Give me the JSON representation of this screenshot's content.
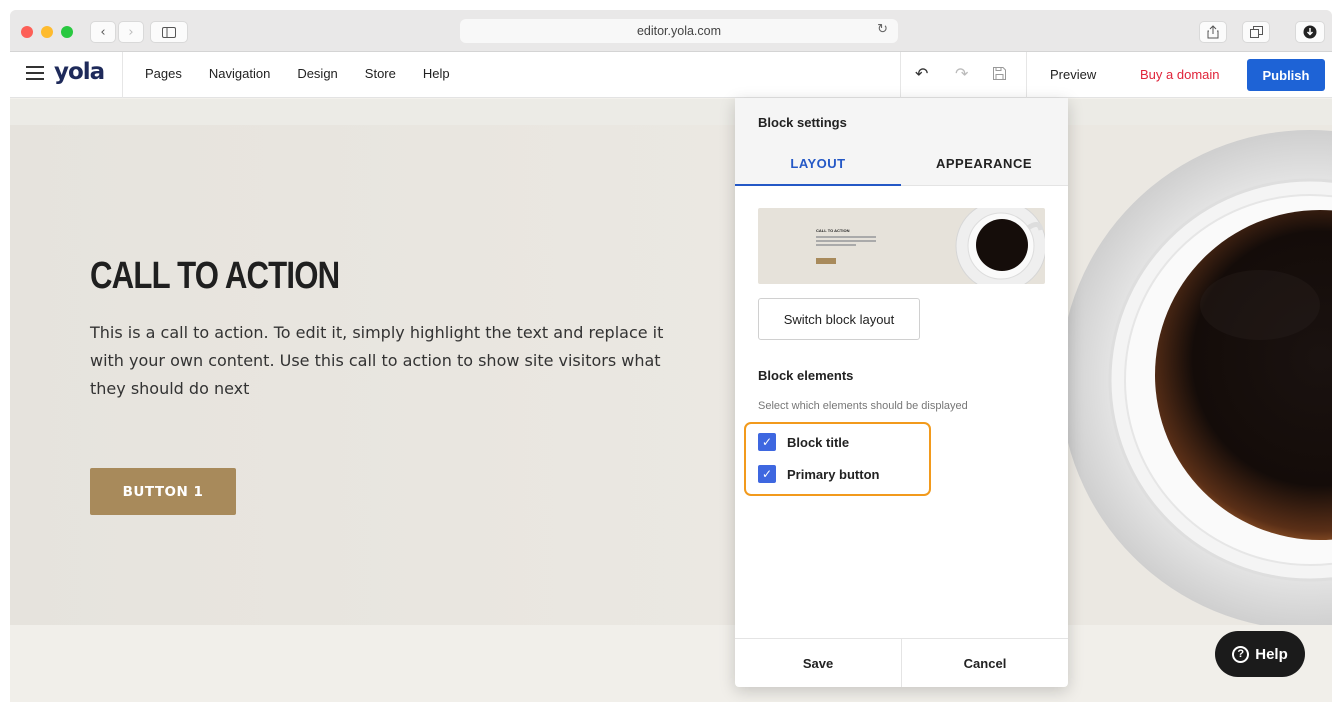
{
  "browser": {
    "url": "editor.yola.com"
  },
  "toolbar": {
    "logo": "yola",
    "nav": [
      "Pages",
      "Navigation",
      "Design",
      "Store",
      "Help"
    ],
    "preview": "Preview",
    "buy_domain": "Buy a domain",
    "publish": "Publish"
  },
  "hero": {
    "title": "CALL TO ACTION",
    "text": "This is a call to action. To edit it, simply highlight the text and replace it with your own content. Use this call to action to show site visitors what they should do next",
    "button": "BUTTON 1"
  },
  "panel": {
    "title": "Block settings",
    "tabs": [
      "LAYOUT",
      "APPEARANCE"
    ],
    "active_tab": "LAYOUT",
    "thumb_title": "CALL TO ACTION",
    "switch_layout": "Switch block layout",
    "elements_title": "Block elements",
    "elements_subtitle": "Select which elements should be displayed",
    "elements": [
      {
        "label": "Block title",
        "checked": true
      },
      {
        "label": "Primary button",
        "checked": true
      }
    ],
    "save": "Save",
    "cancel": "Cancel"
  },
  "help_bubble": "Help",
  "icons": {
    "checkbox": "check-icon",
    "undo": "undo-icon",
    "redo": "redo-icon",
    "save": "save-icon",
    "help": "help-circle-icon"
  },
  "colors": {
    "accent": "#1e63d6",
    "buy_domain": "#e0243a",
    "cta_button": "#a88a5b",
    "highlight": "#f29a1c",
    "checkbox": "#3e67e0"
  }
}
